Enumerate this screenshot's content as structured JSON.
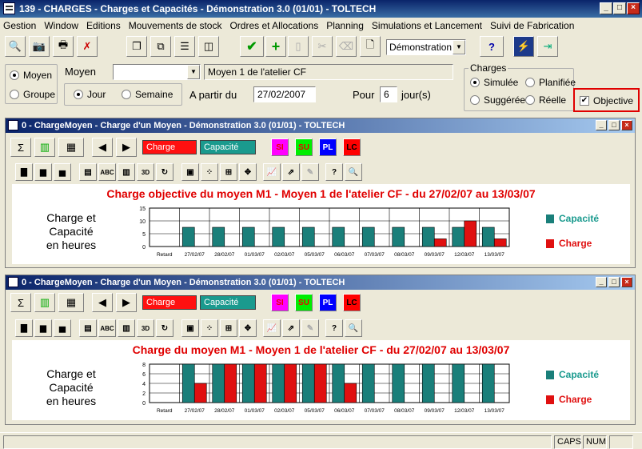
{
  "window": {
    "title": "139 - CHARGES - Charges et Capacités - Démonstration 3.0 (01/01) - TOLTECH"
  },
  "menu": [
    "Gestion",
    "Window",
    "Editions",
    "Mouvements de stock",
    "Ordres et Allocations",
    "Planning",
    "Simulations et Lancement",
    "Suivi de Fabrication"
  ],
  "toolbar": {
    "demo_select": "Démonstration 3"
  },
  "filters": {
    "moyen_radio": "Moyen",
    "groupe_radio": "Groupe",
    "moyen_label": "Moyen",
    "moyen_value": "",
    "moyen_desc": "Moyen 1 de l'atelier CF",
    "jour_radio": "Jour",
    "semaine_radio": "Semaine",
    "a_partir_label": "A partir du",
    "date_value": "27/02/2007",
    "pour_label": "Pour",
    "pour_value": "6",
    "jours_label": "jour(s)",
    "charges_group": "Charges",
    "simulee": "Simulée",
    "planifiee": "Planifiée",
    "suggeree": "Suggérée",
    "reelle": "Réelle",
    "objective": "Objective"
  },
  "child_windows": [
    {
      "title": "0 - ChargeMoyen - Charge d'un Moyen - Démonstration 3.0 (01/01) - TOLTECH",
      "charge_box": "Charge",
      "capacite_box": "Capacité",
      "si": "SI",
      "su": "SU",
      "pl": "PL",
      "lc": "LC",
      "ylabel": [
        "Charge et",
        "Capacité",
        "en heures"
      ],
      "chart_data": {
        "type": "bar",
        "title": "Charge objective du moyen M1 - Moyen 1 de l'atelier CF - du 27/02/07 au 13/03/07",
        "categories": [
          "Retard",
          "27/02/07",
          "28/02/07",
          "01/03/07",
          "02/03/07",
          "05/03/07",
          "06/03/07",
          "07/03/07",
          "08/03/07",
          "09/03/07",
          "12/03/07",
          "13/03/07"
        ],
        "yticks": [
          "15",
          "10",
          "5",
          "0"
        ],
        "ylim": [
          0,
          15
        ],
        "series": [
          {
            "name": "Capacité",
            "color": "#1a7f7a",
            "values": [
              0,
              7.5,
              7.5,
              7.5,
              7.5,
              7.5,
              7.5,
              7.5,
              7.5,
              7.5,
              7.5,
              7.5
            ]
          },
          {
            "name": "Charge",
            "color": "#e01010",
            "values": [
              0,
              0,
              0,
              0,
              0,
              0,
              0,
              0,
              0,
              3,
              10,
              3
            ]
          }
        ]
      }
    },
    {
      "title": "0 - ChargeMoyen - Charge d'un Moyen - Démonstration 3.0 (01/01) - TOLTECH",
      "charge_box": "Charge",
      "capacite_box": "Capacité",
      "si": "SI",
      "su": "SU",
      "pl": "PL",
      "lc": "LC",
      "ylabel": [
        "Charge et",
        "Capacité",
        "en heures"
      ],
      "chart_data": {
        "type": "bar",
        "title": "Charge du moyen M1 - Moyen 1 de l'atelier CF - du 27/02/07 au 13/03/07",
        "categories": [
          "Retard",
          "27/02/07",
          "28/02/07",
          "01/03/07",
          "02/03/07",
          "05/03/07",
          "06/03/07",
          "07/03/07",
          "08/03/07",
          "09/03/07",
          "12/03/07",
          "13/03/07"
        ],
        "yticks": [
          "8",
          "6",
          "4",
          "2",
          "0"
        ],
        "ylim": [
          0,
          8
        ],
        "series": [
          {
            "name": "Capacité",
            "color": "#1a7f7a",
            "values": [
              0,
              8,
              8,
              8,
              8,
              8,
              8,
              8,
              8,
              8,
              8,
              8
            ]
          },
          {
            "name": "Charge",
            "color": "#e01010",
            "values": [
              0,
              4,
              8,
              8,
              8,
              8,
              4,
              0,
              0,
              0,
              0,
              0
            ]
          }
        ]
      }
    }
  ],
  "status": {
    "caps": "CAPS",
    "num": "NUM"
  }
}
